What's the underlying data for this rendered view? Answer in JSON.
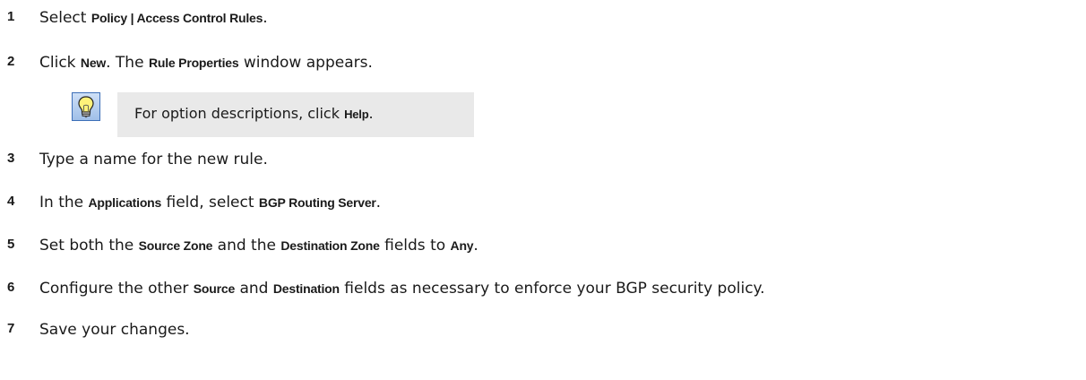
{
  "steps": [
    {
      "num": "1",
      "parts": [
        "Select ",
        "Policy | Access Control Rules",
        "."
      ]
    },
    {
      "num": "2",
      "parts": [
        "Click ",
        "New",
        ". The ",
        "Rule Properties",
        " window appears."
      ]
    },
    {
      "num": "3",
      "parts": [
        "Type a name for the new rule."
      ]
    },
    {
      "num": "4",
      "parts": [
        "In the ",
        "Applications",
        " field, select ",
        "BGP Routing Server",
        "."
      ]
    },
    {
      "num": "5",
      "parts": [
        "Set both the ",
        "Source Zone",
        " and the ",
        "Destination Zone",
        " fields to ",
        "Any",
        "."
      ]
    },
    {
      "num": "6",
      "parts": [
        "Configure the other ",
        "Source",
        " and ",
        "Destination",
        " fields as necessary to enforce your BGP security policy."
      ]
    },
    {
      "num": "7",
      "parts": [
        "Save your changes."
      ]
    }
  ],
  "tip": {
    "icon": "lightbulb-icon",
    "parts": [
      "For option descriptions, click ",
      "Help",
      "."
    ]
  }
}
